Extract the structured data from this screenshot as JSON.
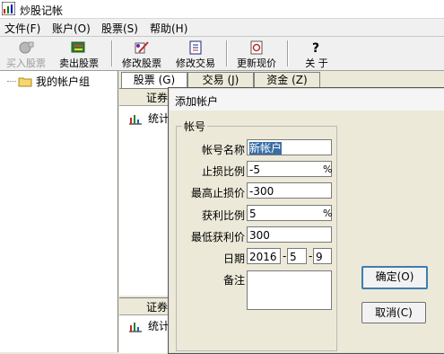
{
  "window": {
    "title": "炒股记帐"
  },
  "menu": [
    "文件(F)",
    "账户(O)",
    "股票(S)",
    "帮助(H)"
  ],
  "toolbar": {
    "buy": "买入股票",
    "sell": "卖出股票",
    "edit_stock": "修改股票",
    "edit_trade": "修改交易",
    "refresh": "更新现价",
    "about": "关 于"
  },
  "tree": {
    "root": "我的帐户组"
  },
  "tabs": [
    "股票 (G)",
    "交易 (J)",
    "资金 (Z)"
  ],
  "panel_top": {
    "header": "证券",
    "stat": "统计"
  },
  "panel_bottom": {
    "header": "证券",
    "stat": "统计"
  },
  "dialog": {
    "title": "添加帐户",
    "group": "帐号",
    "fields": {
      "name_label": "帐号名称",
      "name_value": "新帐户",
      "stoploss_label": "止损比例",
      "stoploss_value": "-5",
      "stoploss_unit": "%",
      "maxloss_label": "最高止损价",
      "maxloss_value": "-300",
      "profit_label": "获利比例",
      "profit_value": "5",
      "profit_unit": "%",
      "minprofit_label": "最低获利价",
      "minprofit_value": "300",
      "date_label": "日期",
      "year": "2016",
      "month": "5",
      "day": "9",
      "sep": "-",
      "note_label": "备注"
    },
    "ok": "确定(O)",
    "cancel": "取消(C)"
  }
}
